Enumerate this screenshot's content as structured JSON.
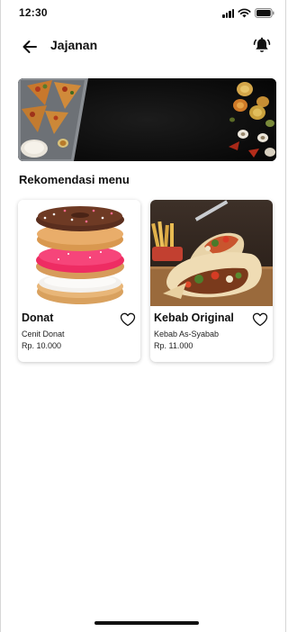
{
  "status_bar": {
    "time": "12:30",
    "icons": [
      "signal-icon",
      "wifi-icon",
      "battery-icon"
    ]
  },
  "app_bar": {
    "title": "Jajanan",
    "back_icon": "arrow-left-icon",
    "notification_icon": "bell-ring-icon"
  },
  "section": {
    "title": "Rekomendasi menu"
  },
  "cards": [
    {
      "name": "Donat",
      "shop": "Cenit Donat",
      "price": "Rp. 10.000",
      "favorite_icon": "heart-outline-icon"
    },
    {
      "name": "Kebab Original",
      "shop": "Kebab As-Syabab",
      "price": "Rp. 11.000",
      "favorite_icon": "heart-outline-icon"
    }
  ],
  "colors": {
    "text": "#111111",
    "banner_bg": "#0b0b0b",
    "card_shadow": "#cccccc"
  }
}
